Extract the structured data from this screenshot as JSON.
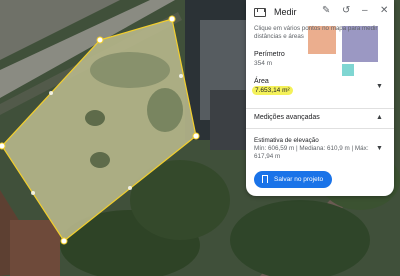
{
  "panel": {
    "title": "Medir",
    "hint": "Clique em vários pontos no mapa para medir distâncias e áreas",
    "perimeter_label": "Perímetro",
    "perimeter_value": "354 m",
    "area_label": "Área",
    "area_value": "7.653,14 m²",
    "advanced_label": "Medições avançadas",
    "elevation_label": "Estimativa de elevação",
    "elevation_value": "Mín: 606,59 m | Mediana: 610,9 m | Máx: 617,94 m",
    "save_button": "Salvar no projeto"
  },
  "icons": {
    "measure": "ruler-icon",
    "edit": "edit-icon",
    "back": "refresh-icon",
    "minimize": "minimize-icon",
    "close": "close-icon"
  },
  "colors": {
    "polygon_stroke": "#f3cf2c",
    "highlight": "#f4f15a",
    "button": "#1a73e8"
  }
}
